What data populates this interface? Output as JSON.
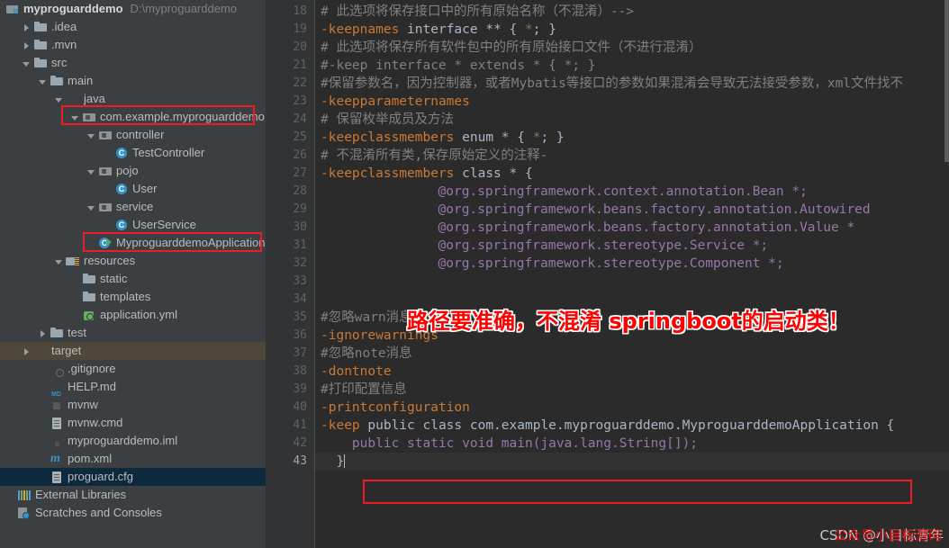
{
  "project": {
    "root_name": "myproguarddemo",
    "root_path": "D:\\myproguarddemo",
    "tree": [
      {
        "label": ".idea",
        "indent": 1,
        "arrow": "right",
        "icon": "folder"
      },
      {
        "label": ".mvn",
        "indent": 1,
        "arrow": "right",
        "icon": "folder"
      },
      {
        "label": "src",
        "indent": 1,
        "arrow": "down",
        "icon": "folder"
      },
      {
        "label": "main",
        "indent": 2,
        "arrow": "down",
        "icon": "folder"
      },
      {
        "label": "java",
        "indent": 3,
        "arrow": "down",
        "icon": "folder-blue"
      },
      {
        "label": "com.example.myproguarddemo",
        "indent": 4,
        "arrow": "down",
        "icon": "pkg"
      },
      {
        "label": "controller",
        "indent": 5,
        "arrow": "down",
        "icon": "pkg"
      },
      {
        "label": "TestController",
        "indent": 6,
        "arrow": "none",
        "icon": "cls"
      },
      {
        "label": "pojo",
        "indent": 5,
        "arrow": "down",
        "icon": "pkg"
      },
      {
        "label": "User",
        "indent": 6,
        "arrow": "none",
        "icon": "cls"
      },
      {
        "label": "service",
        "indent": 5,
        "arrow": "down",
        "icon": "pkg"
      },
      {
        "label": "UserService",
        "indent": 6,
        "arrow": "none",
        "icon": "cls"
      },
      {
        "label": "MyproguarddemoApplication",
        "indent": 5,
        "arrow": "none",
        "icon": "springcls"
      },
      {
        "label": "resources",
        "indent": 3,
        "arrow": "down",
        "icon": "res"
      },
      {
        "label": "static",
        "indent": 4,
        "arrow": "none",
        "icon": "folder"
      },
      {
        "label": "templates",
        "indent": 4,
        "arrow": "none",
        "icon": "folder"
      },
      {
        "label": "application.yml",
        "indent": 4,
        "arrow": "none",
        "icon": "yml"
      },
      {
        "label": "test",
        "indent": 2,
        "arrow": "right",
        "icon": "folder"
      },
      {
        "label": "target",
        "indent": 1,
        "arrow": "right",
        "icon": "folder-orange",
        "highlight": "olive"
      },
      {
        "label": ".gitignore",
        "indent": 2,
        "arrow": "none",
        "icon": "file-gitignore"
      },
      {
        "label": "HELP.md",
        "indent": 2,
        "arrow": "none",
        "icon": "file-md"
      },
      {
        "label": "mvnw",
        "indent": 2,
        "arrow": "none",
        "icon": "file-sh"
      },
      {
        "label": "mvnw.cmd",
        "indent": 2,
        "arrow": "none",
        "icon": "file"
      },
      {
        "label": "myproguarddemo.iml",
        "indent": 2,
        "arrow": "none",
        "icon": "file-iml"
      },
      {
        "label": "pom.xml",
        "indent": 2,
        "arrow": "none",
        "icon": "xml-m"
      },
      {
        "label": "proguard.cfg",
        "indent": 2,
        "arrow": "none",
        "icon": "file",
        "highlight": "blue"
      },
      {
        "label": "External Libraries",
        "indent": 0,
        "arrow": "none",
        "icon": "libs"
      },
      {
        "label": "Scratches and Consoles",
        "indent": 0,
        "arrow": "none",
        "icon": "scratch"
      }
    ]
  },
  "editor": {
    "first_line_number": 18,
    "current_line_number": 43,
    "line_numbers": [
      18,
      19,
      20,
      21,
      22,
      23,
      24,
      25,
      26,
      27,
      28,
      29,
      30,
      31,
      32,
      33,
      34,
      35,
      36,
      37,
      38,
      39,
      40,
      41,
      42,
      43
    ],
    "lines": [
      {
        "n": 18,
        "indent": 0,
        "tokens": [
          {
            "t": "comment",
            "v": "# 此选项将保存接口中的所有原始名称（不混淆）-->"
          }
        ]
      },
      {
        "n": 19,
        "indent": 0,
        "tokens": [
          {
            "t": "key",
            "v": "-keepnames"
          },
          {
            "t": "plain",
            "v": " interface "
          },
          {
            "t": "plain",
            "v": "** { "
          },
          {
            "t": "star",
            "v": "*"
          },
          {
            "t": "plain",
            "v": "; }"
          }
        ]
      },
      {
        "n": 20,
        "indent": 0,
        "tokens": [
          {
            "t": "comment",
            "v": "# 此选项将保存所有软件包中的所有原始接口文件（不进行混淆）"
          }
        ]
      },
      {
        "n": 21,
        "indent": 0,
        "tokens": [
          {
            "t": "comment",
            "v": "#-keep interface * extends * { *; }"
          }
        ]
      },
      {
        "n": 22,
        "indent": 0,
        "tokens": [
          {
            "t": "comment",
            "v": "#保留参数名，因为控制器，或者Mybatis等接口的参数如果混淆会导致无法接受参数，xml文件找不"
          }
        ]
      },
      {
        "n": 23,
        "indent": 0,
        "tokens": [
          {
            "t": "key",
            "v": "-keepparameternames"
          }
        ]
      },
      {
        "n": 24,
        "indent": 0,
        "tokens": [
          {
            "t": "comment",
            "v": "# 保留枚举成员及方法"
          }
        ]
      },
      {
        "n": 25,
        "indent": 0,
        "tokens": [
          {
            "t": "key",
            "v": "-keepclassmembers"
          },
          {
            "t": "plain",
            "v": " enum * { "
          },
          {
            "t": "star",
            "v": "*"
          },
          {
            "t": "plain",
            "v": "; }"
          }
        ]
      },
      {
        "n": 26,
        "indent": 0,
        "tokens": [
          {
            "t": "comment",
            "v": "# 不混淆所有类,保存原始定义的注释-"
          }
        ]
      },
      {
        "n": 27,
        "indent": 0,
        "tokens": [
          {
            "t": "key",
            "v": "-keepclassmembers"
          },
          {
            "t": "plain",
            "v": " class * {"
          }
        ]
      },
      {
        "n": 28,
        "indent": 15,
        "tokens": [
          {
            "t": "ann",
            "v": "@org.springframework.context.annotation.Bean *;"
          }
        ]
      },
      {
        "n": 29,
        "indent": 15,
        "tokens": [
          {
            "t": "ann",
            "v": "@org.springframework.beans.factory.annotation.Autowired"
          }
        ]
      },
      {
        "n": 30,
        "indent": 15,
        "tokens": [
          {
            "t": "ann",
            "v": "@org.springframework.beans.factory.annotation.Value *"
          }
        ]
      },
      {
        "n": 31,
        "indent": 15,
        "tokens": [
          {
            "t": "ann",
            "v": "@org.springframework.stereotype.Service *;"
          }
        ]
      },
      {
        "n": 32,
        "indent": 15,
        "tokens": [
          {
            "t": "ann",
            "v": "@org.springframework.stereotype.Component *;"
          }
        ]
      },
      {
        "n": 33,
        "indent": 0,
        "tokens": []
      },
      {
        "n": 34,
        "indent": 0,
        "tokens": []
      },
      {
        "n": 35,
        "indent": 0,
        "tokens": [
          {
            "t": "comment",
            "v": "#忽略warn消息"
          }
        ]
      },
      {
        "n": 36,
        "indent": 0,
        "tokens": [
          {
            "t": "key",
            "v": "-ignorewarnings"
          }
        ]
      },
      {
        "n": 37,
        "indent": 0,
        "tokens": [
          {
            "t": "comment",
            "v": "#忽略note消息"
          }
        ]
      },
      {
        "n": 38,
        "indent": 0,
        "tokens": [
          {
            "t": "key",
            "v": "-dontnote"
          }
        ]
      },
      {
        "n": 39,
        "indent": 0,
        "tokens": [
          {
            "t": "comment",
            "v": "#打印配置信息"
          }
        ]
      },
      {
        "n": 40,
        "indent": 0,
        "tokens": [
          {
            "t": "key",
            "v": "-printconfiguration"
          }
        ]
      },
      {
        "n": 41,
        "indent": 0,
        "tokens": [
          {
            "t": "key",
            "v": "-keep"
          },
          {
            "t": "plain",
            "v": " public class com.example.myproguarddemo.MyproguarddemoApplication {"
          }
        ]
      },
      {
        "n": 42,
        "indent": 0,
        "tokens": [
          {
            "t": "ann",
            "v": "    public static void main(java.lang.String[]);"
          }
        ]
      },
      {
        "n": 43,
        "indent": 0,
        "tokens": [
          {
            "t": "plain",
            "v": "  }"
          }
        ],
        "caret": true
      }
    ]
  },
  "annotations": {
    "callout_text": "路径要准确，不混淆 springboot的启动类！",
    "watermark": "CSDN @小目标青年",
    "watermark_overlay": "公众号小目标源码",
    "box_color": "#ee1c25",
    "text_color": "#ff0000"
  }
}
